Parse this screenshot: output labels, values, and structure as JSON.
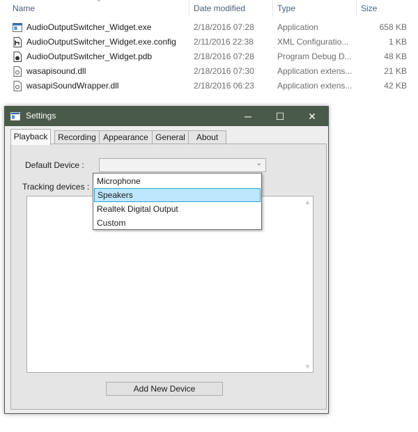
{
  "explorer": {
    "columns": {
      "name": "Name",
      "date": "Date modified",
      "type": "Type",
      "size": "Size"
    },
    "files": [
      {
        "name": "AudioOutputSwitcher_Widget.exe",
        "date": "2/18/2016 07:28",
        "type": "Application",
        "size": "658 KB",
        "icon": "exe-icon"
      },
      {
        "name": "AudioOutputSwitcher_Widget.exe.config",
        "date": "2/11/2016 22:38",
        "type": "XML Configuratio...",
        "size": "1 KB",
        "icon": "config-file-icon"
      },
      {
        "name": "AudioOutputSwitcher_Widget.pdb",
        "date": "2/18/2016 07:28",
        "type": "Program Debug D...",
        "size": "48 KB",
        "icon": "pdb-file-icon"
      },
      {
        "name": "wasapisound.dll",
        "date": "2/18/2016 07:30",
        "type": "Application extens...",
        "size": "21 KB",
        "icon": "dll-file-icon"
      },
      {
        "name": "wasapiSoundWrapper.dll",
        "date": "2/18/2016 06:23",
        "type": "Application extens...",
        "size": "42 KB",
        "icon": "dll-file-icon"
      }
    ]
  },
  "window": {
    "title": "Settings",
    "controls": {
      "minimize": "─",
      "maximize": "☐",
      "close": "✕"
    },
    "tabs": [
      {
        "label": "Playback",
        "active": true
      },
      {
        "label": "Recording",
        "active": false
      },
      {
        "label": "Appearance",
        "active": false
      },
      {
        "label": "General",
        "active": false
      },
      {
        "label": "About",
        "active": false
      }
    ],
    "playback": {
      "default_device_label": "Default Device :",
      "default_device_value": "",
      "tracking_label": "Tracking devices :",
      "add_button": "Add New Device"
    },
    "dropdown_options": [
      {
        "label": "Microphone",
        "selected": false
      },
      {
        "label": "Speakers",
        "selected": true
      },
      {
        "label": "Realtek Digital Output",
        "selected": false
      },
      {
        "label": "Custom",
        "selected": false
      }
    ]
  },
  "colors": {
    "titlebar": "#4a5a4a",
    "selection_bg": "#bee6fd",
    "selection_border": "#26a0da"
  }
}
